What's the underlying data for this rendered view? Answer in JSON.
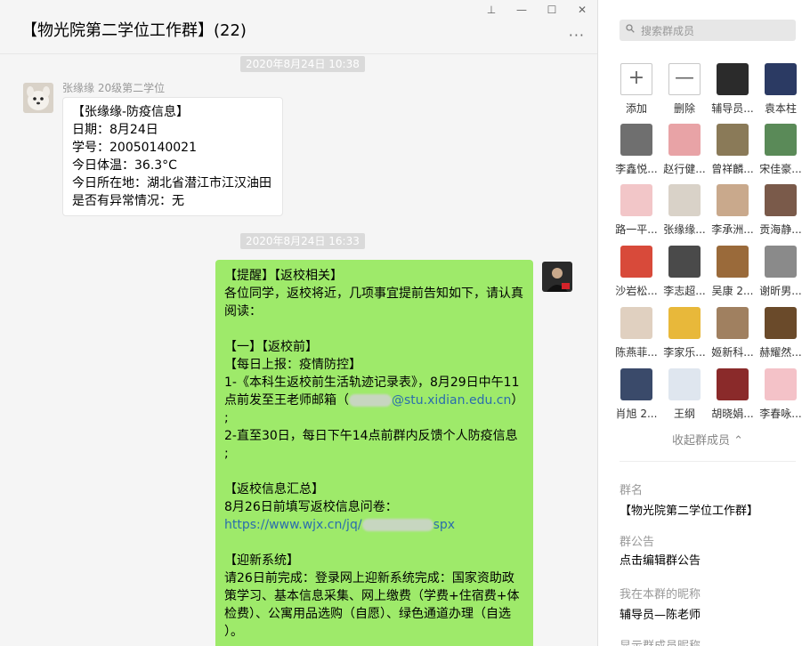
{
  "window": {
    "pin_icon": "pin-icon",
    "minimize_icon": "minimize-icon",
    "maximize_icon": "maximize-icon",
    "close_icon": "close-icon"
  },
  "chat": {
    "title": "【物光院第二学位工作群】(22)",
    "more_label": "···",
    "messages": [
      {
        "timestamp": "2020年8月24日 10:38",
        "sender": "张缘缘 20级第二学位",
        "lines": [
          "【张缘缘-防疫信息】",
          "日期：8月24日",
          "学号：20050140021",
          "今日体温：36.3°C",
          "今日所在地：湖北省潜江市江汉油田",
          "是否有异常情况：无"
        ]
      },
      {
        "timestamp": "2020年8月24日 16:33",
        "lines": [
          "【提醒】【返校相关】",
          "各位同学，返校将近，几项事宜提前告知如下，请认真",
          "阅读：",
          "",
          "【一】【返校前】",
          "【每日上报：疫情防控】",
          "1-《本科生返校前生活轨迹记录表》，8月29日中午11",
          "",
          ";",
          "2-直至30日，每日下午14点前群内反馈个人防疫信息",
          ";",
          "",
          "【返校信息汇总】",
          "8月26日前填写返校信息问卷：",
          "",
          "",
          "【迎新系统】",
          "请26日前完成：登录网上迎新系统完成：国家资助政",
          "策学习、基本信息采集、网上缴费（学费+住宿费+体",
          "检费）、公寓用品选购（自愿）、绿色通道办理（自选",
          "）。"
        ],
        "email_prefix": "点前发至王老师邮箱（",
        "email_domain": "@stu.xidian.edu.cn",
        "email_suffix": "）",
        "link_prefix": "https://www.wjx.cn/jq/",
        "link_suffix": "spx"
      }
    ]
  },
  "panel": {
    "search_placeholder": "搜索群成员",
    "actions": [
      {
        "icon": "plus-icon",
        "glyph": "+",
        "label": "添加"
      },
      {
        "icon": "minus-icon",
        "glyph": "—",
        "label": "删除"
      }
    ],
    "members": [
      "辅导员...",
      "袁本柱",
      "李鑫悦...",
      "赵行健...",
      "曾祥麟...",
      "宋佳豪...",
      "路一平...",
      "张缘缘...",
      "李承洲...",
      "贡海静...",
      "沙岩松...",
      "李志超...",
      "吴康 2...",
      "谢昕男...",
      "陈燕菲...",
      "李家乐...",
      "姬新科...",
      "赫耀然...",
      "肖旭 2...",
      "王纲",
      "胡晓娟...",
      "李春咏..."
    ],
    "collapse_label": "收起群成员",
    "group_name_label": "群名",
    "group_name_value": "【物光院第二学位工作群】",
    "announcement_label": "群公告",
    "announcement_value": "点击编辑群公告",
    "nickname_label": "我在本群的昵称",
    "nickname_value": "辅导员—陈老师",
    "show_nick_label": "显示群成员昵称"
  },
  "colors": {
    "bubble_out": "#9eea6a",
    "link": "#2b6dad",
    "timestamp_bg": "#dadada"
  }
}
